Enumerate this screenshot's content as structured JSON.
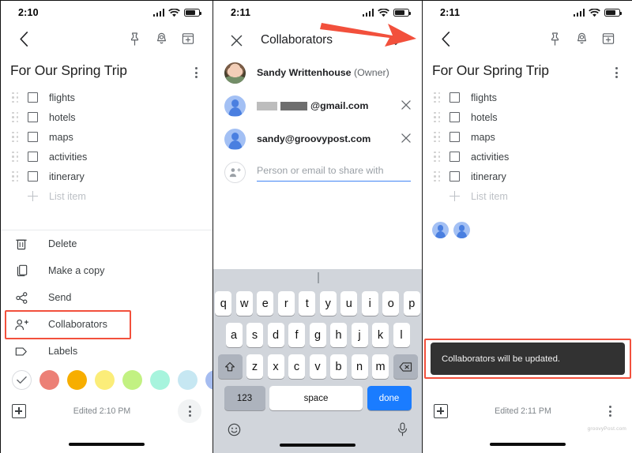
{
  "panels": {
    "left": {
      "status": {
        "time": "2:10"
      },
      "toolbar": {
        "back": "back-arrow",
        "pin": "pin-icon",
        "reminder": "bell-icon",
        "archive": "archive-icon"
      },
      "note": {
        "title": "For Our Spring Trip",
        "items": [
          {
            "label": "flights"
          },
          {
            "label": "hotels"
          },
          {
            "label": "maps"
          },
          {
            "label": "activities"
          },
          {
            "label": "itinerary"
          }
        ],
        "add_placeholder": "List item"
      },
      "menu": {
        "items": [
          {
            "label": "Delete",
            "icon": "trash-icon"
          },
          {
            "label": "Make a copy",
            "icon": "copy-icon"
          },
          {
            "label": "Send",
            "icon": "share-icon"
          },
          {
            "label": "Collaborators",
            "icon": "person-add-icon",
            "highlighted": true
          },
          {
            "label": "Labels",
            "icon": "label-icon"
          }
        ],
        "colors": [
          {
            "name": "none",
            "hex": "#ffffff"
          },
          {
            "name": "coral",
            "hex": "#ec8076"
          },
          {
            "name": "orange",
            "hex": "#f7ae00"
          },
          {
            "name": "yellow",
            "hex": "#fbed79"
          },
          {
            "name": "green",
            "hex": "#c2f182"
          },
          {
            "name": "mint",
            "hex": "#a7f4dd"
          },
          {
            "name": "light-blue",
            "hex": "#c6e7f2"
          },
          {
            "name": "periwinkle",
            "hex": "#a5bcf0"
          }
        ]
      },
      "footer": {
        "edited": "Edited 2:10 PM"
      }
    },
    "middle": {
      "status": {
        "time": "2:11"
      },
      "header": {
        "title": "Collaborators",
        "close": "close-icon",
        "confirm": "check-icon"
      },
      "collaborators": [
        {
          "type": "owner",
          "name": "Sandy Writtenhouse",
          "role": "(Owner)",
          "avatar": "photo"
        },
        {
          "type": "member",
          "email_suffix": "@gmail.com",
          "redacted": true,
          "avatar": "person"
        },
        {
          "type": "member",
          "email": "sandy@groovypost.com",
          "redacted": false,
          "avatar": "person"
        }
      ],
      "share_input": {
        "placeholder": "Person or email to share with",
        "icon": "person-add-icon"
      },
      "keyboard": {
        "row1": [
          "q",
          "w",
          "e",
          "r",
          "t",
          "y",
          "u",
          "i",
          "o",
          "p"
        ],
        "row2": [
          "a",
          "s",
          "d",
          "f",
          "g",
          "h",
          "j",
          "k",
          "l"
        ],
        "row3": [
          "z",
          "x",
          "c",
          "v",
          "b",
          "n",
          "m"
        ],
        "shift": "shift-icon",
        "backspace": "backspace-icon",
        "numbers": "123",
        "space": "space",
        "done": "done",
        "emoji": "emoji-icon",
        "mic": "microphone-icon"
      }
    },
    "right": {
      "status": {
        "time": "2:11"
      },
      "toolbar": {
        "back": "back-arrow",
        "pin": "pin-icon",
        "reminder": "bell-icon",
        "archive": "archive-icon"
      },
      "note": {
        "title": "For Our Spring Trip",
        "items": [
          {
            "label": "flights"
          },
          {
            "label": "hotels"
          },
          {
            "label": "maps"
          },
          {
            "label": "activities"
          },
          {
            "label": "itinerary"
          }
        ],
        "add_placeholder": "List item",
        "collaborator_count": 2
      },
      "toast": {
        "message": "Collaborators will be updated."
      },
      "footer": {
        "edited": "Edited 2:11 PM"
      },
      "watermark": "groovyPost.com"
    }
  },
  "annotations": {
    "arrow_color": "#f2503c",
    "highlight_color": "#f2503c"
  }
}
